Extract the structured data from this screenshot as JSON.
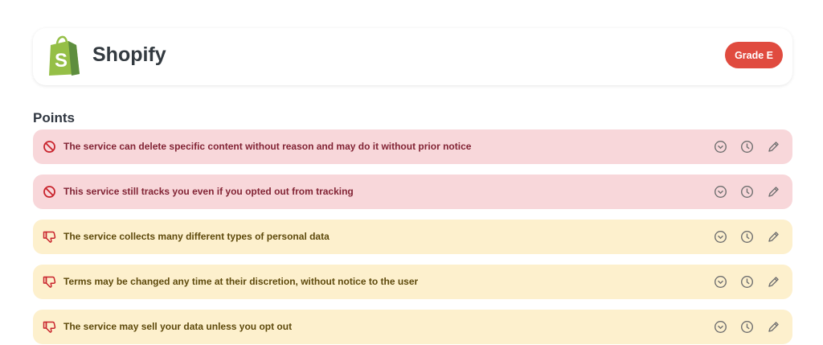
{
  "service": {
    "name": "Shopify",
    "grade": "Grade E",
    "logo_icon": "shopify-bag-logo",
    "logo_letter": "S"
  },
  "section": {
    "title": "Points"
  },
  "points": [
    {
      "title": "The service can delete specific content without reason and may do it without prior notice",
      "rating": "blocker",
      "icon": "ban-icon"
    },
    {
      "title": "This service still tracks you even if you opted out from tracking",
      "rating": "blocker",
      "icon": "ban-icon"
    },
    {
      "title": "The service collects many different types of personal data",
      "rating": "bad",
      "icon": "thumbs-down-icon"
    },
    {
      "title": "Terms may be changed any time at their discretion, without notice to the user",
      "rating": "bad",
      "icon": "thumbs-down-icon"
    },
    {
      "title": "The service may sell your data unless you opt out",
      "rating": "bad",
      "icon": "thumbs-down-icon"
    }
  ],
  "point_actions": [
    "expand-chevron-icon",
    "history-clock-icon",
    "edit-pencil-icon"
  ],
  "colors": {
    "grade_badge": "#e04b3f",
    "blocker_bg": "#f8d7da",
    "blocker_text": "#822435",
    "bad_bg": "#fdf0cd",
    "bad_text": "#5e4a0c",
    "shopify_green": "#95bf47"
  }
}
